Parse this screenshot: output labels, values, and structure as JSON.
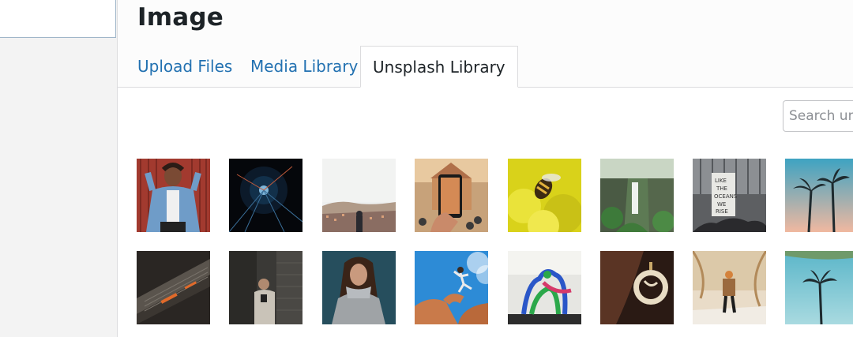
{
  "modal": {
    "title": "Image"
  },
  "tabs": [
    {
      "label": "Upload Files",
      "active": false
    },
    {
      "label": "Media Library",
      "active": false
    },
    {
      "label": "Unsplash Library",
      "active": true
    }
  ],
  "search": {
    "placeholder": "Search unsplash"
  },
  "gallery": {
    "rows": [
      [
        {
          "name": "photo-woman-denim-jacket"
        },
        {
          "name": "photo-light-tunnel"
        },
        {
          "name": "photo-city-overlook"
        },
        {
          "name": "photo-phone-temple"
        },
        {
          "name": "photo-bee-yellow-flowers"
        },
        {
          "name": "photo-waterfall"
        },
        {
          "name": "photo-ocean-protest-sign"
        },
        {
          "name": "photo-palm-trees-sky"
        }
      ],
      [
        {
          "name": "photo-escalator"
        },
        {
          "name": "photo-man-phone-corridor"
        },
        {
          "name": "photo-woman-scarf"
        },
        {
          "name": "photo-jumping-rock-arch"
        },
        {
          "name": "photo-colorful-sculpture"
        },
        {
          "name": "photo-earring-closeup"
        },
        {
          "name": "photo-hiker-beach"
        },
        {
          "name": "photo-palm-tree-single"
        }
      ]
    ]
  },
  "colors": {
    "link": "#2271b1",
    "text": "#1d2327"
  }
}
